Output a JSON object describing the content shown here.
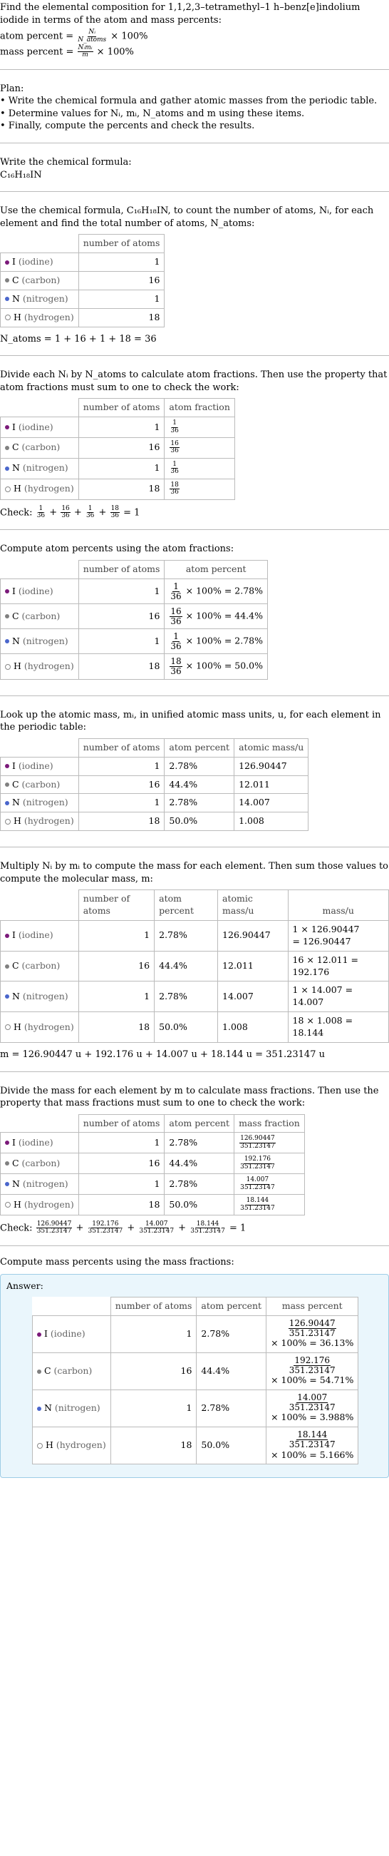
{
  "intro": {
    "text": "Find the elemental composition for 1,1,2,3–tetramethyl–1 h–benz[e]indolium iodide in terms of the atom and mass percents:",
    "atom_percent_label": "atom percent = ",
    "atom_percent_num": "Nᵢ",
    "atom_percent_den": "N_atoms",
    "atom_percent_tail": " × 100%",
    "mass_percent_label": "mass percent = ",
    "mass_percent_num": "Nᵢmᵢ",
    "mass_percent_den": "m",
    "mass_percent_tail": " × 100%"
  },
  "plan": {
    "title": "Plan:",
    "items": [
      "• Write the chemical formula and gather atomic masses from the periodic table.",
      "• Determine values for Nᵢ, mᵢ, N_atoms and m using these items.",
      "• Finally, compute the percents and check the results."
    ]
  },
  "formula_section": {
    "text": "Write the chemical formula:",
    "formula": "C₁₆H₁₈IN"
  },
  "elements": [
    {
      "symbol": "I",
      "name": "iodine",
      "color": "#7b1a7a",
      "hollow": false,
      "count": "1",
      "atom_fraction_num": "1",
      "atom_percent_expr_num": "1",
      "atom_percent_value": "2.78%",
      "atom_percent": "2.78%",
      "atomic_mass": "126.90447",
      "mass_line1": "1 × 126.90447",
      "mass_line2": "= 126.90447",
      "mass_fraction_num": "126.90447",
      "mass_percent_value": "36.13%"
    },
    {
      "symbol": "C",
      "name": "carbon",
      "color": "#808080",
      "hollow": false,
      "count": "16",
      "atom_fraction_num": "16",
      "atom_percent_expr_num": "16",
      "atom_percent_value": "44.4%",
      "atom_percent": "44.4%",
      "atomic_mass": "12.011",
      "mass_line1": "16 × 12.011 = 192.176",
      "mass_line2": "",
      "mass_fraction_num": "192.176",
      "mass_percent_value": "54.71%"
    },
    {
      "symbol": "N",
      "name": "nitrogen",
      "color": "#4a66cc",
      "hollow": false,
      "count": "1",
      "atom_fraction_num": "1",
      "atom_percent_expr_num": "1",
      "atom_percent_value": "2.78%",
      "atom_percent": "2.78%",
      "atomic_mass": "14.007",
      "mass_line1": "1 × 14.007 = 14.007",
      "mass_line2": "",
      "mass_fraction_num": "14.007",
      "mass_percent_value": "3.988%"
    },
    {
      "symbol": "H",
      "name": "hydrogen",
      "color": "#ffffff",
      "hollow": true,
      "count": "18",
      "atom_fraction_num": "18",
      "atom_percent_expr_num": "18",
      "atom_percent_value": "50.0%",
      "atom_percent": "50.0%",
      "atomic_mass": "1.008",
      "mass_line1": "18 × 1.008 = 18.144",
      "mass_line2": "",
      "mass_fraction_num": "18.144",
      "mass_percent_value": "5.166%"
    }
  ],
  "count_section": {
    "text_a": "Use the chemical formula, C₁₆H₁₈IN, to count the number of atoms, Nᵢ, for each element and find the total number of atoms, N_atoms:",
    "header_number": "number of atoms",
    "total": "N_atoms = 1 + 16 + 1 + 18 = 36"
  },
  "fraction_section": {
    "text": "Divide each Nᵢ by N_atoms to calculate atom fractions. Then use the property that atom fractions must sum to one to check the work:",
    "header_number": "number of atoms",
    "header_fraction": "atom fraction",
    "denominator": "36",
    "check_label": "Check: ",
    "check_result": " = 1"
  },
  "atom_percent_section": {
    "text": "Compute atom percents using the atom fractions:",
    "header_number": "number of atoms",
    "header_percent": "atom percent",
    "times": " × 100% = "
  },
  "mass_lookup_section": {
    "text": "Look up the atomic mass, mᵢ, in unified atomic mass units, u, for each element in the periodic table:",
    "header_number": "number of atoms",
    "header_percent": "atom percent",
    "header_mass": "atomic mass/u"
  },
  "molecular_mass_section": {
    "text": "Multiply Nᵢ by mᵢ to compute the mass for each element. Then sum those values to compute the molecular mass, m:",
    "header_number": "number of atoms",
    "header_percent": "atom percent",
    "header_mass": "atomic mass/u",
    "header_massu": "mass/u",
    "total": "m = 126.90447 u + 192.176 u + 14.007 u + 18.144 u = 351.23147 u"
  },
  "mass_fraction_section": {
    "text": "Divide the mass for each element by m to calculate mass fractions. Then use the property that mass fractions must sum to one to check the work:",
    "header_number": "number of atoms",
    "header_percent": "atom percent",
    "header_fraction": "mass fraction",
    "denominator": "351.23147",
    "check_label": "Check: ",
    "check_result": " = 1"
  },
  "answer_section": {
    "text": "Compute mass percents using the mass fractions:",
    "answer_label": "Answer:",
    "header_number": "number of atoms",
    "header_percent": "atom percent",
    "header_masspct": "mass percent",
    "denominator": "351.23147",
    "times": "× 100% = "
  }
}
